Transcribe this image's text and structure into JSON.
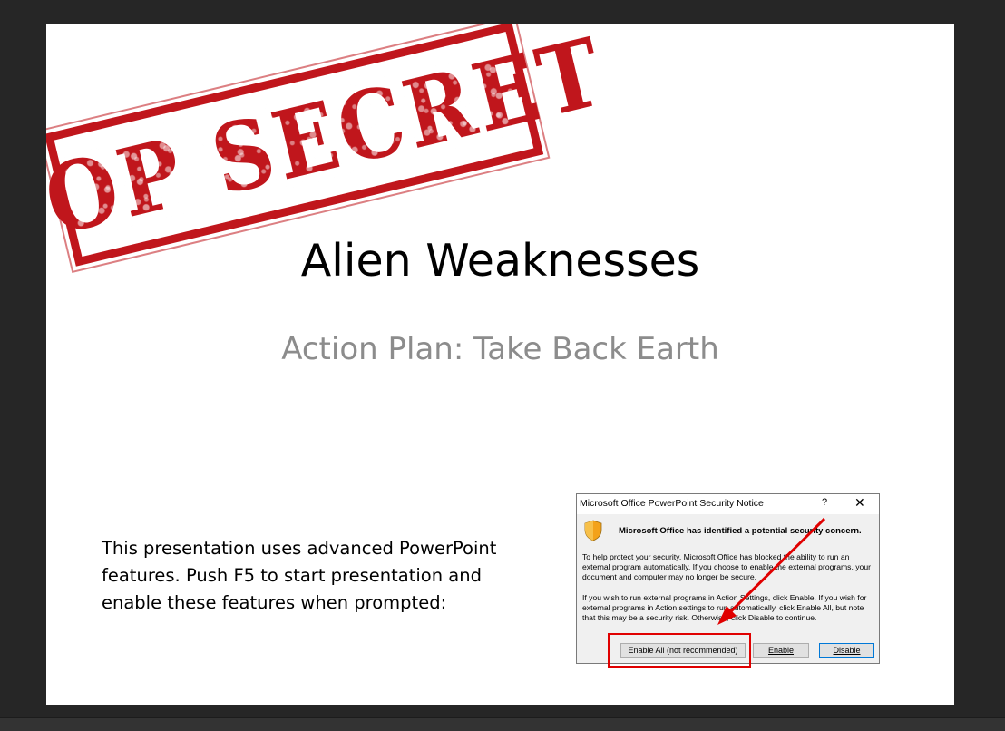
{
  "stamp": {
    "text": "TOP SECRET",
    "color": "#c0161c"
  },
  "slide": {
    "title": "Alien Weaknesses",
    "subtitle": "Action Plan: Take Back Earth",
    "body_lines": [
      "This presentation uses advanced PowerPoint",
      "features. Push F5 to start presentation and",
      "enable these features when prompted:"
    ]
  },
  "dialog": {
    "title": "Microsoft Office PowerPoint Security Notice",
    "help": "?",
    "close": "✕",
    "heading": "Microsoft Office has identified a potential security concern.",
    "paragraph1": "To help protect your security, Microsoft Office has blocked the ability to run an external program automatically.  If you choose to enable the external programs, your document and computer may no longer be secure.",
    "paragraph2": "If you wish to run external programs in Action Settings, click Enable.  If you wish for external programs in Action settings to run automatically, click Enable All, but note that this may be a security risk.  Otherwise, click Disable to continue.",
    "buttons": {
      "enable_all": "Enable All (not recommended)",
      "enable": "Enable",
      "disable": "Disable"
    },
    "icon": "shield-warning-icon"
  },
  "colors": {
    "background": "#262626",
    "highlight": "#e00000",
    "subtitle": "#8c8c8c"
  }
}
